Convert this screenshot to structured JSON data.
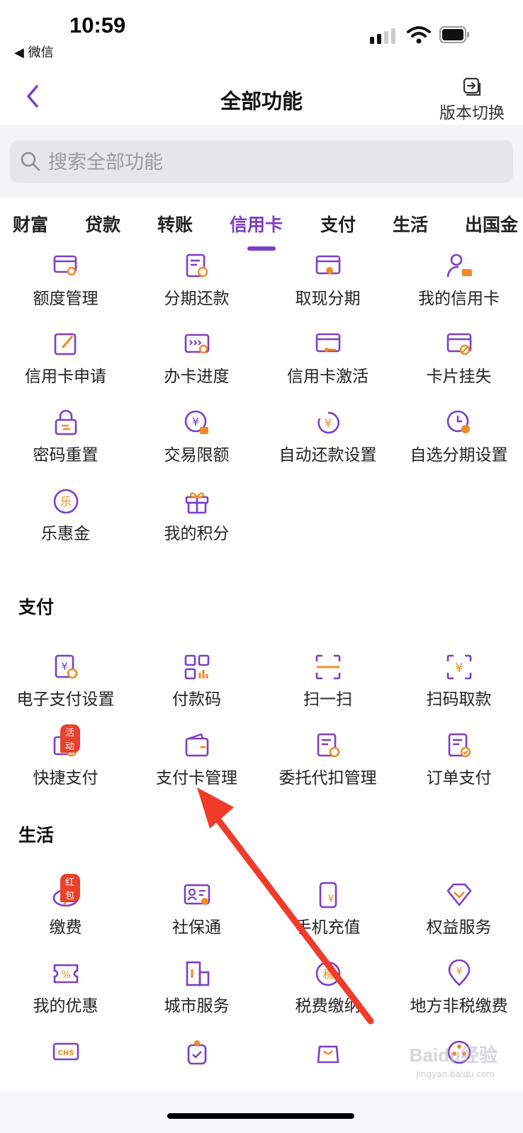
{
  "status_bar": {
    "time": "10:59",
    "back_app": "◀ 微信"
  },
  "nav": {
    "title": "全部功能",
    "switch_label": "版本切换"
  },
  "search": {
    "placeholder": "搜索全部功能"
  },
  "tabs": [
    {
      "label": "财富"
    },
    {
      "label": "贷款"
    },
    {
      "label": "转账"
    },
    {
      "label": "信用卡",
      "active": true
    },
    {
      "label": "支付"
    },
    {
      "label": "生活"
    },
    {
      "label": "出国金"
    }
  ],
  "credit_card_items": [
    {
      "label": "额度管理",
      "icon": "card-search-icon"
    },
    {
      "label": "分期还款",
      "icon": "bill-clock-icon"
    },
    {
      "label": "取现分期",
      "icon": "card-coin-icon"
    },
    {
      "label": "我的信用卡",
      "icon": "user-card-icon"
    },
    {
      "label": "信用卡申请",
      "icon": "edit-icon"
    },
    {
      "label": "办卡进度",
      "icon": "card-progress-icon"
    },
    {
      "label": "信用卡激活",
      "icon": "card-key-icon"
    },
    {
      "label": "卡片挂失",
      "icon": "card-block-icon"
    },
    {
      "label": "密码重置",
      "icon": "lock-icon"
    },
    {
      "label": "交易限额",
      "icon": "yuan-lock-icon"
    },
    {
      "label": "自动还款设置",
      "icon": "yuan-cycle-icon"
    },
    {
      "label": "自选分期设置",
      "icon": "clock-gear-icon"
    },
    {
      "label": "乐惠金",
      "icon": "le-coin-icon"
    },
    {
      "label": "我的积分",
      "icon": "gift-icon"
    }
  ],
  "payment": {
    "title": "支付",
    "items": [
      {
        "label": "电子支付设置",
        "icon": "yuan-doc-gear-icon"
      },
      {
        "label": "付款码",
        "icon": "qr-code-icon"
      },
      {
        "label": "扫一扫",
        "icon": "scan-icon"
      },
      {
        "label": "扫码取款",
        "icon": "scan-yuan-icon"
      },
      {
        "label": "快捷支付",
        "icon": "quick-pay-icon",
        "badge": "活动"
      },
      {
        "label": "支付卡管理",
        "icon": "wallet-icon"
      },
      {
        "label": "委托代扣管理",
        "icon": "doc-gear-icon"
      },
      {
        "label": "订单支付",
        "icon": "order-check-icon"
      }
    ]
  },
  "life": {
    "title": "生活",
    "items": [
      {
        "label": "缴费",
        "icon": "bolt-pay-icon",
        "badge": "红包"
      },
      {
        "label": "社保通",
        "icon": "id-card-icon"
      },
      {
        "label": "手机充值",
        "icon": "phone-yuan-icon"
      },
      {
        "label": "权益服务",
        "icon": "diamond-icon"
      },
      {
        "label": "我的优惠",
        "icon": "coupon-icon"
      },
      {
        "label": "城市服务",
        "icon": "building-icon"
      },
      {
        "label": "税费缴纳",
        "icon": "tax-icon"
      },
      {
        "label": "地方非税缴费",
        "icon": "location-yuan-icon"
      },
      {
        "label": "",
        "icon": "chs-icon"
      },
      {
        "label": "",
        "icon": "medal-check-icon"
      },
      {
        "label": "",
        "icon": "bag-icon"
      },
      {
        "label": "",
        "icon": "film-reel-icon"
      }
    ]
  },
  "watermark": {
    "text": "Baidu经验",
    "sub": "jingyan.baidu.com"
  },
  "colors": {
    "accent": "#7b3fc6",
    "icon_orange": "#f08a24",
    "badge_red": "#e8412c",
    "arrow_red": "#f03a2a"
  }
}
